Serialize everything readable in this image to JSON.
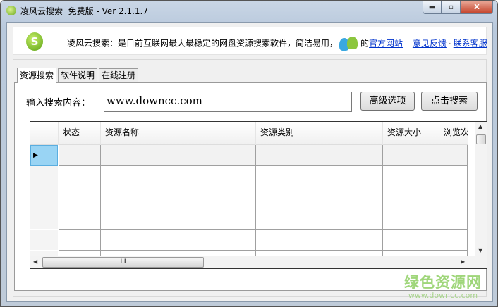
{
  "window": {
    "title": "凌风云搜索  免费版 - Ver 2.1.1.7",
    "min": "▬",
    "max": "▫",
    "close": "X"
  },
  "banner": {
    "text": "凌风云搜索：是目前互联网最大最稳定的网盘资源搜索软件，简洁易用，",
    "suffix": "的",
    "links": [
      "官方网站",
      "意见反馈",
      "联系客服"
    ],
    "sep": "·"
  },
  "tabs": [
    "资源搜索",
    "软件说明",
    "在线注册"
  ],
  "search": {
    "label": "输入搜索内容：",
    "value": "www.downcc.com",
    "advanced": "高级选项",
    "search": "点击搜索"
  },
  "grid": {
    "columns": [
      "状态",
      "资源名称",
      "资源类别",
      "资源大小",
      "浏览次"
    ],
    "scroll_thumb": "III"
  },
  "watermark": {
    "title": "绿色资源网",
    "url": "www.downcc.com"
  }
}
